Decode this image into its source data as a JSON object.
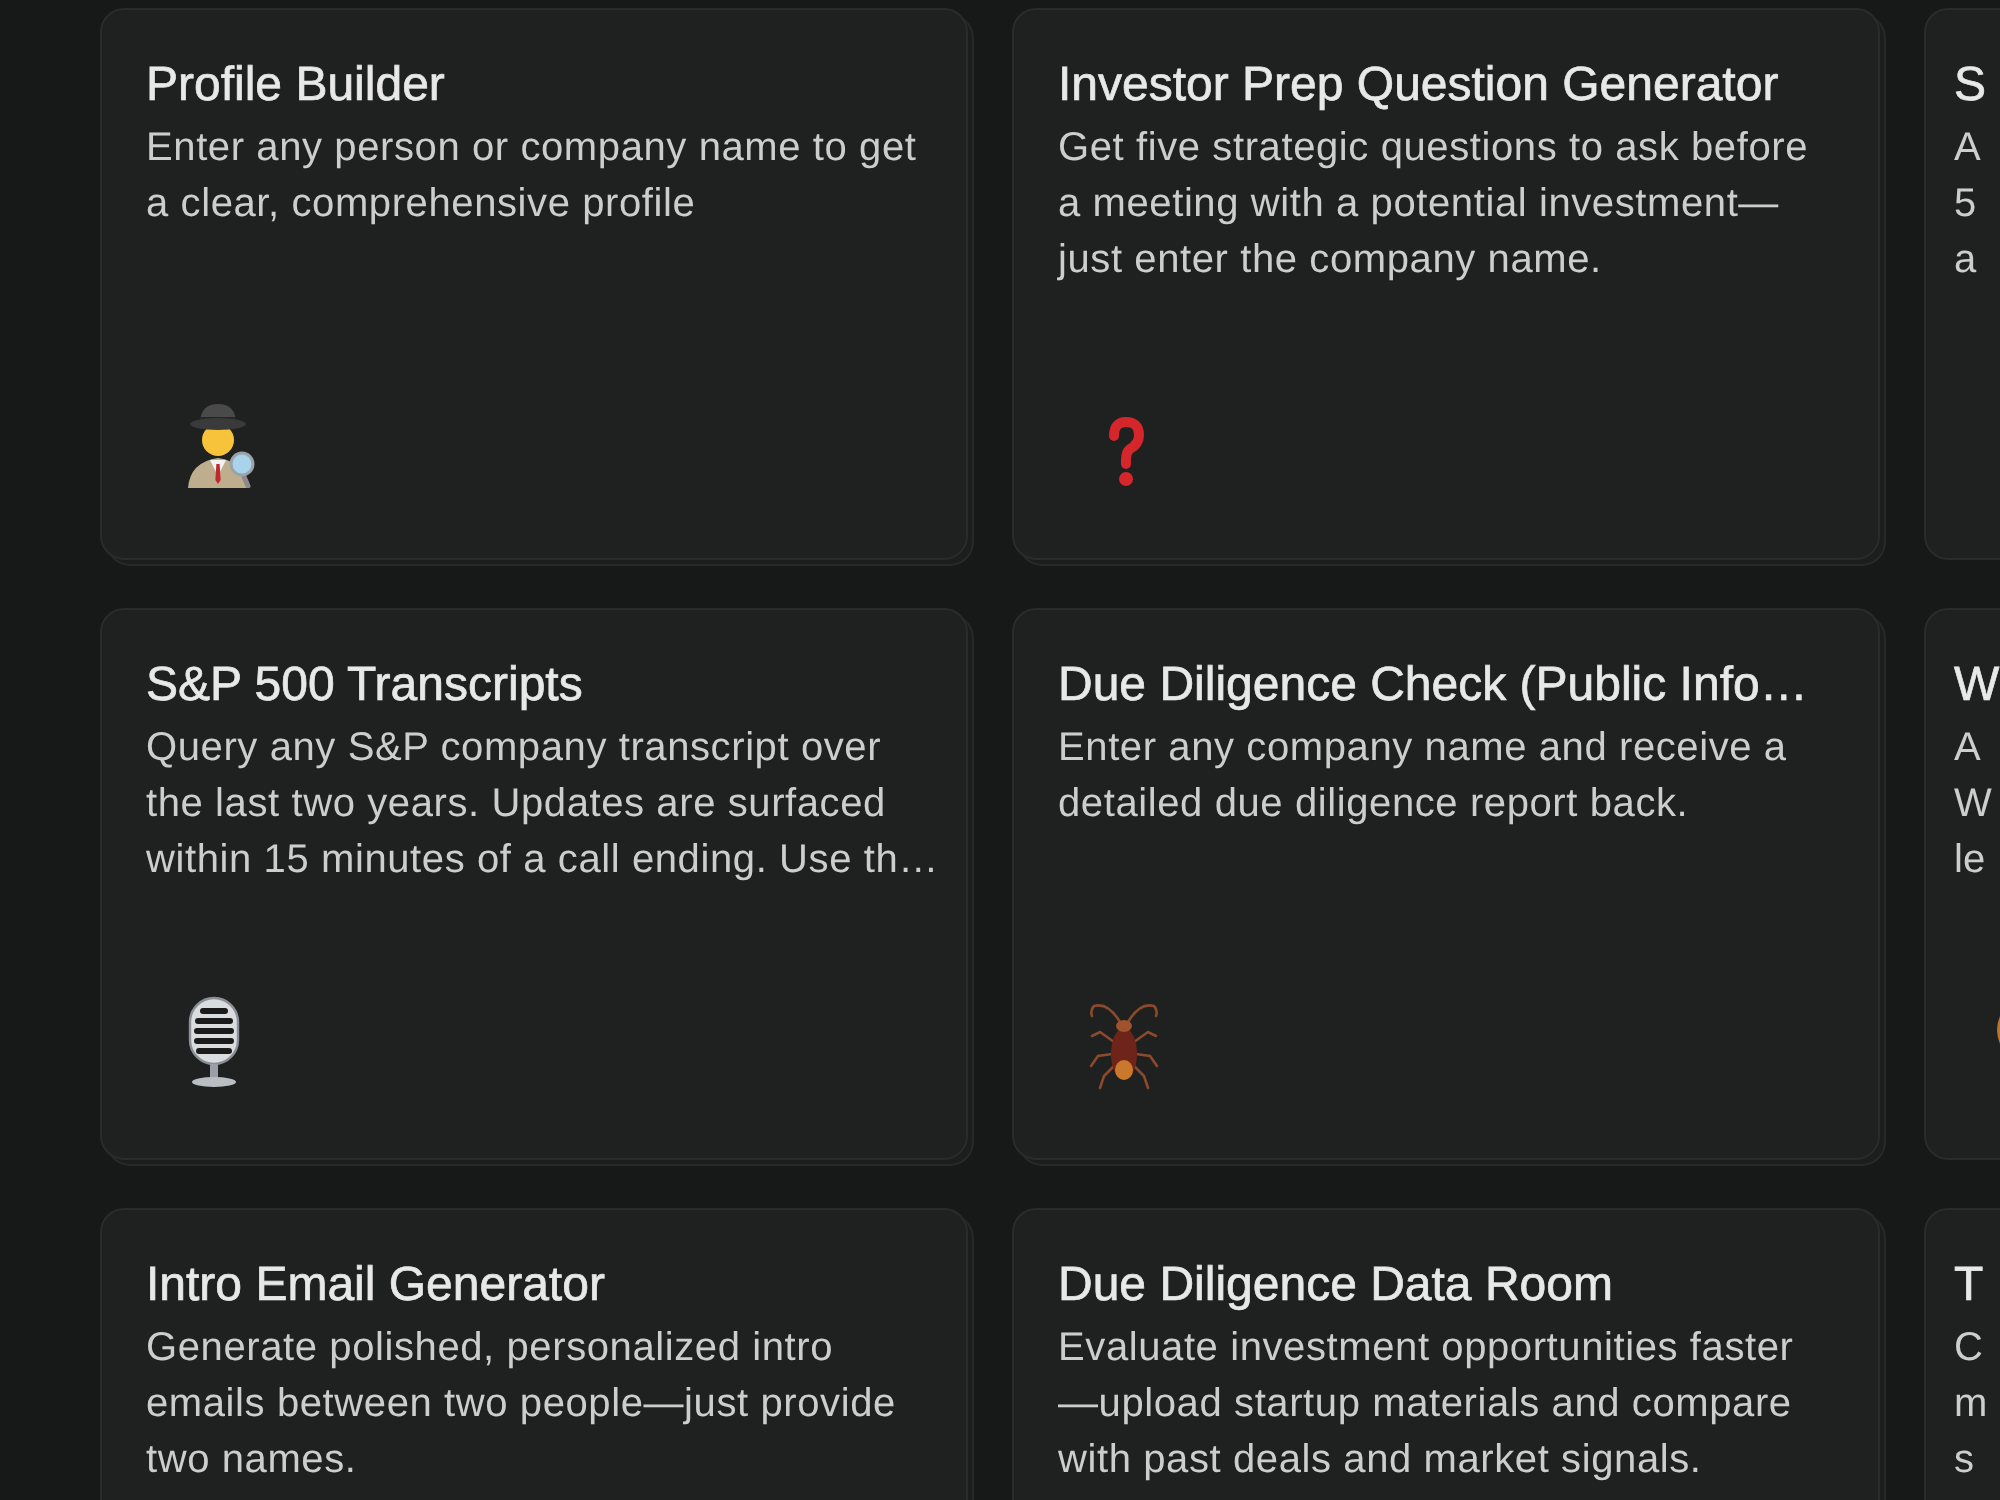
{
  "cards": [
    {
      "kind": "detective",
      "title": "Profile Builder",
      "description": "Enter any person or company name to get\na clear, comprehensive profile"
    },
    {
      "kind": "question",
      "title": "Investor Prep Question Generator",
      "description": "Get five strategic questions to ask before\na meeting with a potential investment—\njust enter the company name."
    },
    {
      "kind": "plain",
      "title": "S",
      "description": "A\n5\na"
    },
    {
      "kind": "microphone",
      "title": "S&P 500 Transcripts",
      "description": "Query any S&P company transcript over\nthe last two years. Updates are surfaced\nwithin 15 minutes of a call ending. Use th…"
    },
    {
      "kind": "cockroach",
      "title": "Due Diligence Check (Public Info…",
      "description": "Enter any company name and receive a\ndetailed due diligence report back."
    },
    {
      "kind": "clipped",
      "title": "W",
      "description": "A\nW\nle"
    },
    {
      "kind": "plain",
      "title": "Intro Email Generator",
      "description": "Generate polished, personalized intro\nemails between two people—just provide\ntwo names."
    },
    {
      "kind": "plain",
      "title": "Due Diligence Data Room",
      "description": "Evaluate investment opportunities faster\n—upload startup materials and compare\nwith past deals and market signals."
    },
    {
      "kind": "plain",
      "title": "T",
      "description": "C\nm\ns"
    }
  ]
}
